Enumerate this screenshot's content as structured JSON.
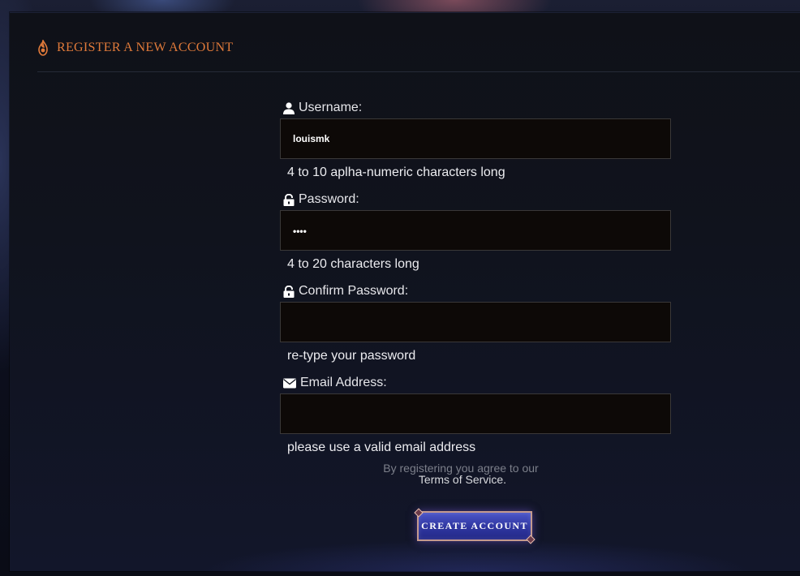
{
  "header": {
    "title": "REGISTER A NEW ACCOUNT",
    "icon": "flame-icon",
    "accent_color": "#e07a3a"
  },
  "form": {
    "username": {
      "label": "Username:",
      "icon": "user-icon",
      "value": "louismk",
      "hint": "4 to 10 aplha-numeric characters long"
    },
    "password": {
      "label": "Password:",
      "icon": "lock-open-icon",
      "value": "••••",
      "hint": "4 to 20 characters long"
    },
    "confirm_password": {
      "label": "Confirm Password:",
      "icon": "lock-open-icon",
      "value": "",
      "hint": "re-type your password"
    },
    "email": {
      "label": "Email Address:",
      "icon": "envelope-icon",
      "value": "",
      "hint": "please use a valid email address"
    }
  },
  "terms": {
    "line1": "By registering you agree to our",
    "link": "Terms of Service."
  },
  "submit": {
    "label": "CREATE ACCOUNT",
    "color": "#2f36a0"
  }
}
